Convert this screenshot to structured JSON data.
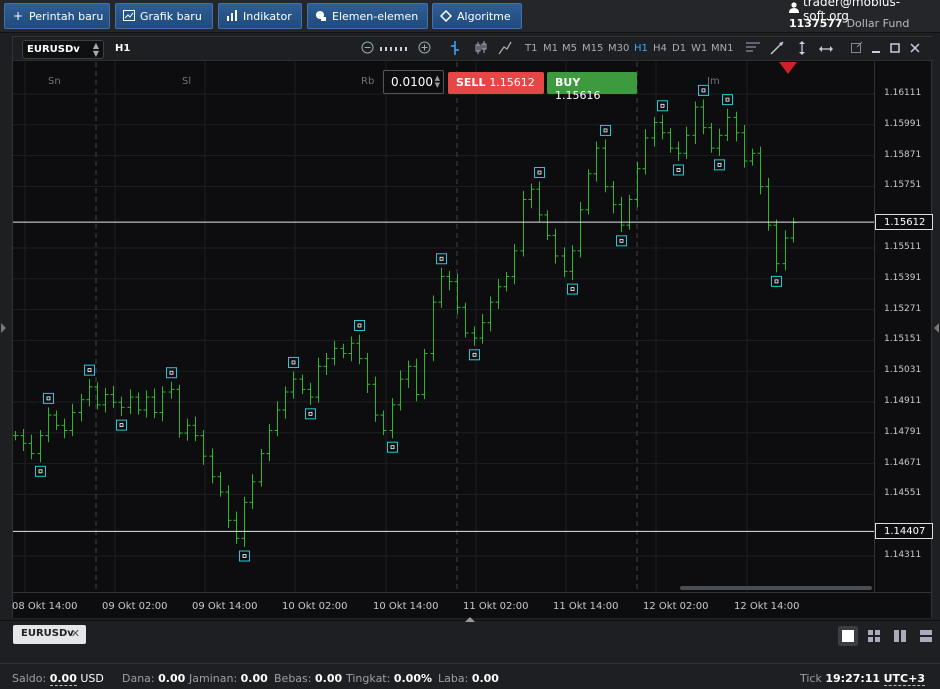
{
  "toolbar": {
    "new_order": "Perintah baru",
    "new_chart": "Grafik baru",
    "indicators": "Indikator",
    "elements": "Elemen-elemen",
    "algorithms": "Algoritme"
  },
  "account": {
    "email": "trader@mobius-soft.org",
    "number": "1137577",
    "fund": "Dollar Fund"
  },
  "chart": {
    "symbol": "EURUSDv",
    "timeframe": "H1",
    "timeframes": [
      "T1",
      "M1",
      "M5",
      "M15",
      "M30",
      "H1",
      "H4",
      "D1",
      "W1",
      "MN1"
    ],
    "active_timeframe": "H1",
    "lot": "0.0100",
    "sell_label": "SELL",
    "sell_price": "1.15612",
    "buy_label": "BUY",
    "buy_price": "1.15616",
    "day_labels": [
      "Sn",
      "Sl",
      "Rb",
      "Jm"
    ],
    "price_labels": [
      "1.16111",
      "1.15991",
      "1.15871",
      "1.15751",
      "1.15511",
      "1.15391",
      "1.15271",
      "1.15151",
      "1.15031",
      "1.14911",
      "1.14791",
      "1.14671",
      "1.14551",
      "1.14311"
    ],
    "current_price": "1.15612",
    "low_line_price": "1.14407",
    "time_labels": [
      "08 Okt 14:00",
      "09 Okt 02:00",
      "09 Okt 14:00",
      "10 Okt 02:00",
      "10 Okt 14:00",
      "11 Okt 02:00",
      "11 Okt 14:00",
      "12 Okt 02:00",
      "12 Okt 14:00"
    ],
    "colors": {
      "bull": "#2fb52f",
      "bear": "#2fb52f",
      "fractal": "#28c8d8",
      "sell": "#e64646",
      "buy": "#3e9a3e",
      "marker": "#d0202a"
    }
  },
  "chart_data": {
    "type": "candlestick-bars",
    "symbol": "EURUSDv",
    "timeframe": "H1",
    "ylim": [
      1.1424,
      1.1625
    ],
    "x": [
      "08 Okt 14:00",
      "09 Okt 02:00",
      "09 Okt 14:00",
      "10 Okt 02:00",
      "10 Okt 14:00",
      "11 Okt 02:00",
      "11 Okt 14:00",
      "12 Okt 02:00",
      "12 Okt 14:00"
    ],
    "close_series": [
      1.1478,
      1.1475,
      1.1471,
      1.1478,
      1.1486,
      1.1482,
      1.148,
      1.1487,
      1.1492,
      1.1497,
      1.149,
      1.1494,
      1.1491,
      1.1489,
      1.1493,
      1.1488,
      1.1493,
      1.1487,
      1.1495,
      1.1496,
      1.1479,
      1.1482,
      1.1478,
      1.147,
      1.1462,
      1.1456,
      1.1445,
      1.1438,
      1.1452,
      1.146,
      1.1471,
      1.148,
      1.1488,
      1.1495,
      1.15,
      1.1496,
      1.1493,
      1.1505,
      1.1508,
      1.1512,
      1.151,
      1.1514,
      1.1508,
      1.1498,
      1.1486,
      1.148,
      1.149,
      1.15,
      1.1505,
      1.1494,
      1.151,
      1.153,
      1.154,
      1.1538,
      1.1528,
      1.1518,
      1.1516,
      1.1522,
      1.153,
      1.1536,
      1.154,
      1.155,
      1.157,
      1.1574,
      1.1564,
      1.1556,
      1.1548,
      1.1542,
      1.155,
      1.1566,
      1.158,
      1.159,
      1.1575,
      1.1568,
      1.156,
      1.157,
      1.1582,
      1.1594,
      1.16,
      1.1596,
      1.159,
      1.1588,
      1.1595,
      1.1606,
      1.1598,
      1.159,
      1.1595,
      1.1602,
      1.1596,
      1.1585,
      1.1588,
      1.1575,
      1.156,
      1.1545,
      1.1555,
      1.1561
    ]
  },
  "bottom": {
    "tab_label": "EURUSDv",
    "saldo_label": "Saldo:",
    "saldo_value": "0.00",
    "saldo_ccy": "USD",
    "dana_label": "Dana:",
    "dana_value": "0.00",
    "jaminan_label": "Jaminan:",
    "jaminan_value": "0.00",
    "bebas_label": "Bebas:",
    "bebas_value": "0.00",
    "tingkat_label": "Tingkat:",
    "tingkat_value": "0.00%",
    "laba_label": "Laba:",
    "laba_value": "0.00",
    "tick_label": "Tick",
    "time": "19:27:11",
    "tz": "UTC+3"
  }
}
